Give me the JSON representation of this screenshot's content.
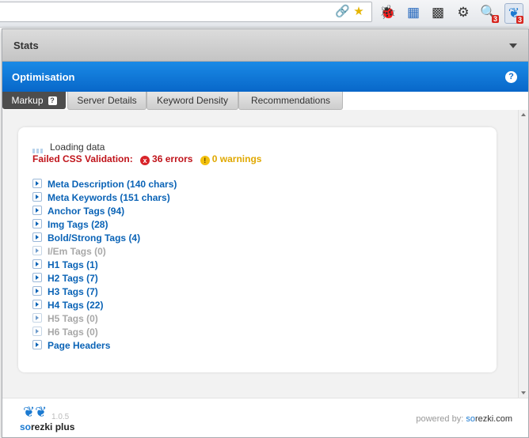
{
  "popup": {
    "stats_title": "Stats",
    "optimisation_title": "Optimisation",
    "help_symbol": "?",
    "tabs": [
      {
        "label": "Markup",
        "active": true,
        "help": "?"
      },
      {
        "label": "Server Details",
        "active": false
      },
      {
        "label": "Keyword Density",
        "active": false
      },
      {
        "label": "Recommendations",
        "active": false
      }
    ],
    "loading_text": "Loading data",
    "validation": {
      "label": "Failed CSS Validation:",
      "error_icon": "x",
      "errors": "36 errors",
      "warning_icon": "!",
      "warnings": "0 warnings"
    },
    "items": [
      {
        "label": "Meta Description (140 chars)",
        "enabled": true
      },
      {
        "label": "Meta Keywords (151 chars)",
        "enabled": true
      },
      {
        "label": "Anchor Tags (94)",
        "enabled": true
      },
      {
        "label": "Img Tags (28)",
        "enabled": true
      },
      {
        "label": "Bold/Strong Tags (4)",
        "enabled": true
      },
      {
        "label": "I/Em Tags (0)",
        "enabled": false
      },
      {
        "label": "H1 Tags (1)",
        "enabled": true
      },
      {
        "label": "H2 Tags (7)",
        "enabled": true
      },
      {
        "label": "H3 Tags (7)",
        "enabled": true
      },
      {
        "label": "H4 Tags (22)",
        "enabled": true
      },
      {
        "label": "H5 Tags (0)",
        "enabled": false
      },
      {
        "label": "H6 Tags (0)",
        "enabled": false
      },
      {
        "label": "Page Headers",
        "enabled": true
      }
    ],
    "footer": {
      "version": "1.0.5",
      "brand_so": "so",
      "brand_rest": "rezki plus",
      "powered_prefix": "powered by: ",
      "powered_so": "so",
      "powered_rest": "rezki.com"
    }
  },
  "toolbar": {
    "icons": [
      "link-icon",
      "star-icon",
      "bug-icon",
      "extension-icon",
      "evernote-icon",
      "wrench-icon",
      "search-extension-icon",
      "sorezki-icon"
    ],
    "badges": {
      "search": "3",
      "sorezki": "3"
    }
  },
  "colors": {
    "optimisation_bar": "#0a6acb",
    "link": "#0a63b6",
    "error": "#c0141b",
    "warning": "#e0a800",
    "disabled": "#a8a8a8"
  }
}
